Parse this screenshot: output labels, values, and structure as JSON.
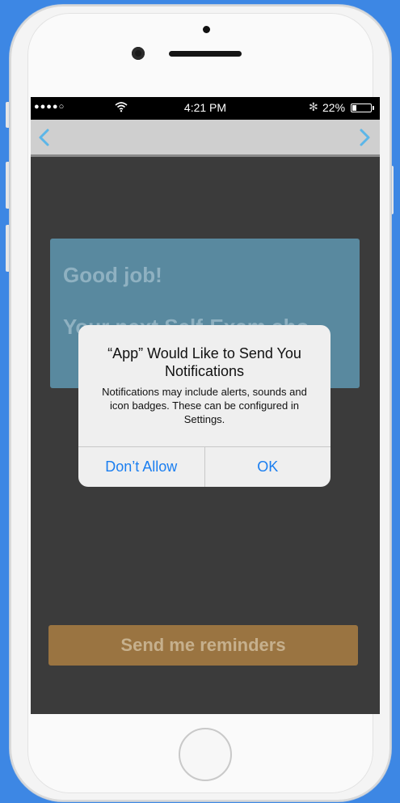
{
  "status_bar": {
    "signal": "●●●●○",
    "time": "4:21 PM",
    "bluetooth": "✻",
    "battery_percent": "22%",
    "battery_level": 0.22
  },
  "nav": {
    "back_icon": "chevron-left-icon",
    "forward_icon": "chevron-right-icon",
    "accent_color": "#5bb6e8"
  },
  "card": {
    "title": "Good job!",
    "subtitle": "Your next Self-Exam sho"
  },
  "reminder_button": {
    "label": "Send me reminders"
  },
  "alert": {
    "title": "“App” Would Like to Send You Notifications",
    "message": "Notifications may include alerts, sounds and icon badges. These can be configured in Settings.",
    "actions": [
      {
        "label": "Don’t Allow"
      },
      {
        "label": "OK"
      }
    ],
    "action_color": "#1a7ef0"
  }
}
